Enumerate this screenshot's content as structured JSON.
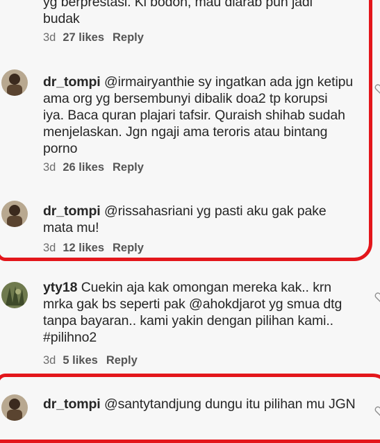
{
  "comments": [
    {
      "username": "",
      "text_lines": [
        "yg berprestasi. Ki bodoh, mau diarab pun jadi",
        "budak"
      ],
      "time": "3d",
      "likes": "27 likes",
      "reply": "Reply"
    },
    {
      "username": "dr_tompi",
      "text_lines": [
        "@irmairyanthie sy ingatkan ada jgn ketipu",
        "ama org yg bersembunyi dibalik doa2 tp korupsi",
        "iya. Baca quran plajari tafsir. Quraish shihab sudah",
        "menjelaskan. Jgn ngaji ama teroris atau bintang",
        "porno"
      ],
      "time": "3d",
      "likes": "26 likes",
      "reply": "Reply"
    },
    {
      "username": "dr_tompi",
      "text_lines": [
        "@rissahasriani yg pasti aku gak pake",
        "mata mu!"
      ],
      "time": "3d",
      "likes": "12 likes",
      "reply": "Reply"
    },
    {
      "username": "yty18",
      "text_lines": [
        "Cuekin aja kak omongan mereka kak.. krn",
        "mrka gak bs seperti pak @ahokdjarot yg smua dtg",
        "tanpa bayaran.. kami yakin dengan pilihan kami..",
        "#pilihno2"
      ],
      "time": "3d",
      "likes": "5 likes",
      "reply": "Reply"
    },
    {
      "username": "dr_tompi",
      "text_lines": [
        "@santytandjung dungu itu pilihan mu JGN"
      ],
      "time": "",
      "likes": "",
      "reply": ""
    }
  ],
  "colors": {
    "highlight": "#e3161b",
    "background": "#f7f7f7"
  },
  "icons": [
    "avatar-photo",
    "heart-icon"
  ]
}
